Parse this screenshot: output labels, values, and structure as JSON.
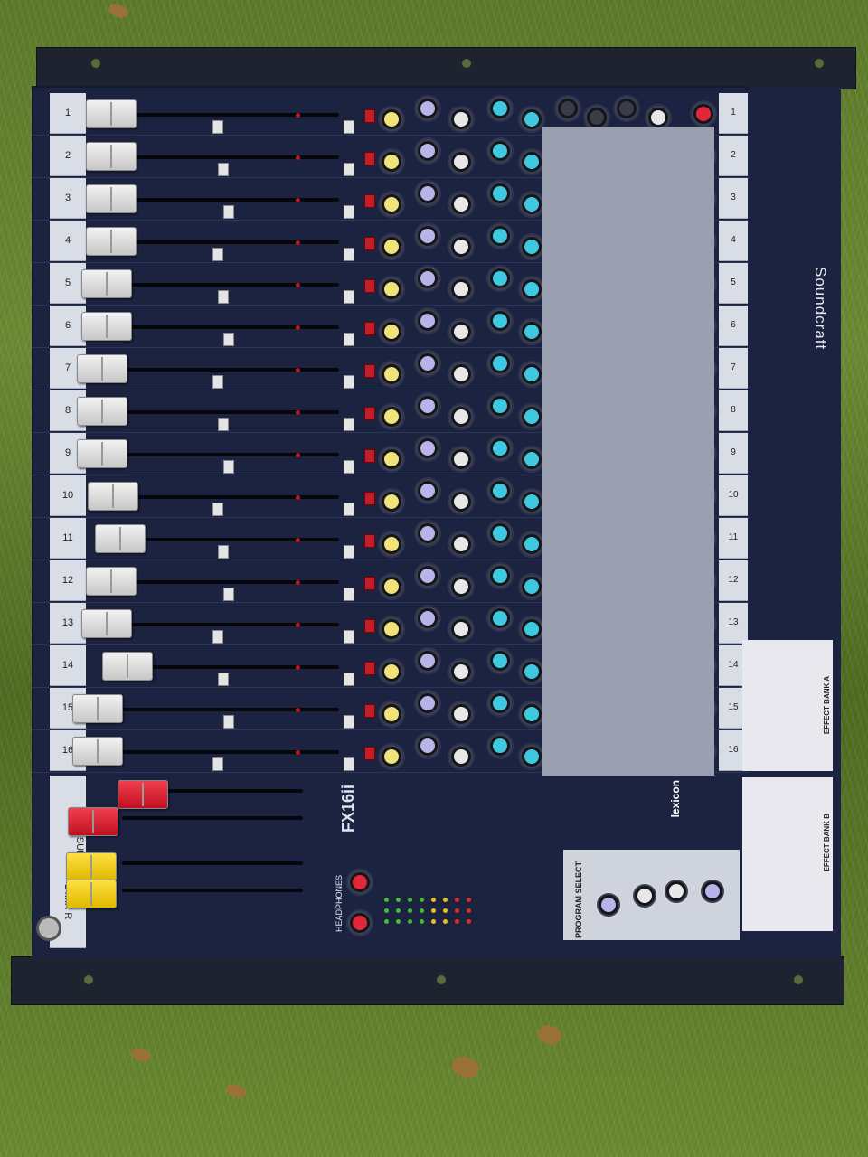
{
  "brand": {
    "logo_text": "Soundcraft",
    "model": "FX16ii",
    "fx_brand": "lexicon"
  },
  "channels": [
    "1",
    "2",
    "3",
    "4",
    "5",
    "6",
    "7",
    "8",
    "9",
    "10",
    "11",
    "12",
    "13",
    "14",
    "15",
    "16"
  ],
  "master": {
    "sub_label": "L SUB R",
    "mix_label": "L MIX R",
    "program_select": "PROGRAM SELECT",
    "effect_bank_a": "EFFECT BANK A",
    "effect_bank_b": "EFFECT BANK B",
    "headphones": "HEADPHONES"
  },
  "colors": {
    "panel": "#1c2340",
    "knob_yellow": "#f2e27a",
    "knob_lavender": "#b8b3e8",
    "knob_white": "#e8e8e8",
    "knob_cyan": "#3ec9e0",
    "knob_red": "#e0283a",
    "fader_red": "#e02030",
    "fader_yellow": "#f4d21a"
  }
}
